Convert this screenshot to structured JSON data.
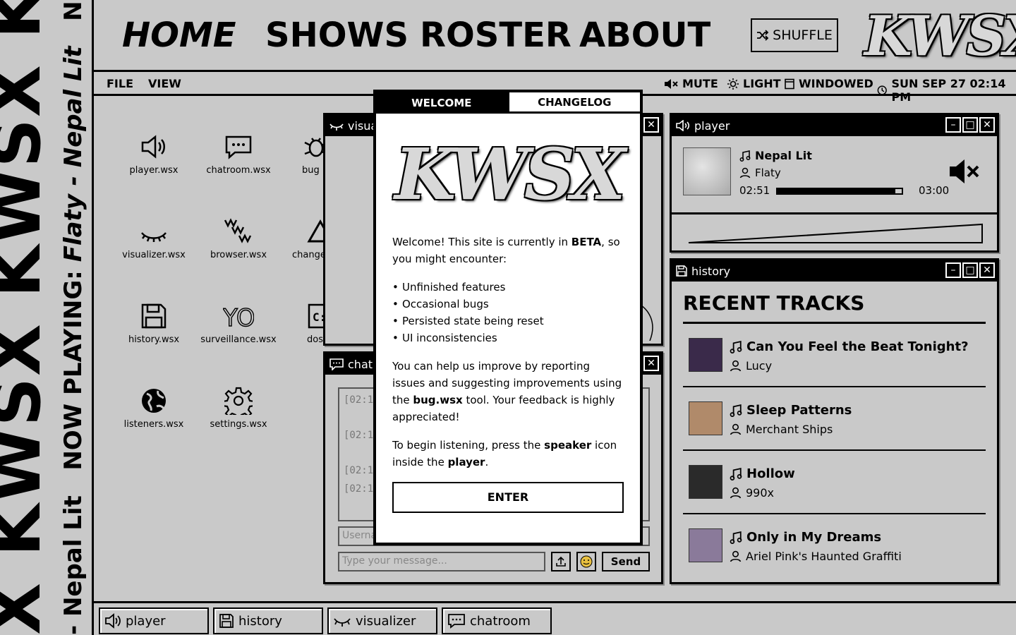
{
  "banner": {
    "big": "X KWSX KWSX KWSX KWSX",
    "now_playing_prefix": "- Nepal Lit   NOW PLAYING: ",
    "now_playing_track": "Flaty - Nepal Lit",
    "now_playing_suffix": "   NOW PLA"
  },
  "nav": {
    "home": "HOME",
    "shows": "SHOWS",
    "roster": "ROSTER",
    "about": "ABOUT",
    "shuffle": "SHUFFLE",
    "logo": "KWSX"
  },
  "menubar": {
    "file": "FILE",
    "view": "VIEW",
    "mute": "MUTE",
    "light": "LIGHT",
    "windowed": "WINDOWED",
    "datetime": "SUN SEP 27 02:14 PM"
  },
  "desktop_icons": [
    {
      "label": "player.wsx",
      "icon": "speaker-icon"
    },
    {
      "label": "chatroom.wsx",
      "icon": "chat-icon"
    },
    {
      "label": "bug",
      "icon": "bug-icon"
    },
    {
      "label": "visualizer.wsx",
      "icon": "eye-closed-icon"
    },
    {
      "label": "browser.wsx",
      "icon": "www-icon"
    },
    {
      "label": "change",
      "icon": "changelog-icon"
    },
    {
      "label": "history.wsx",
      "icon": "floppy-icon"
    },
    {
      "label": "surveillance.wsx",
      "icon": "you-icon"
    },
    {
      "label": "dos",
      "icon": "dos-icon"
    },
    {
      "label": "listeners.wsx",
      "icon": "globe-icon"
    },
    {
      "label": "settings.wsx",
      "icon": "gear-icon"
    }
  ],
  "visualizer_window": {
    "title": "visual"
  },
  "chat_window": {
    "title": "chatro",
    "log": [
      "[02:1",
      "[02:1",
      "[02:1",
      "[02:1"
    ],
    "username_placeholder": "Userna",
    "message_placeholder": "Type your message...",
    "send": "Send"
  },
  "player": {
    "title": "player",
    "track": "Nepal Lit",
    "artist": "Flaty",
    "current_time": "02:51",
    "total_time": "03:00",
    "progress": 0.95
  },
  "history": {
    "title": "history",
    "heading": "RECENT TRACKS",
    "tracks": [
      {
        "title": "Can You Feel the Beat Tonight?",
        "artist": "Lucy",
        "thumb_color": "#3a2a4a"
      },
      {
        "title": "Sleep Patterns",
        "artist": "Merchant Ships",
        "thumb_color": "#b08a6a"
      },
      {
        "title": "Hollow",
        "artist": "990x",
        "thumb_color": "#2a2a2a"
      },
      {
        "title": "Only in My Dreams",
        "artist": "Ariel Pink's Haunted Graffiti",
        "thumb_color": "#8a7a9a"
      }
    ]
  },
  "taskbar": [
    {
      "label": "player",
      "icon": "speaker-icon"
    },
    {
      "label": "history",
      "icon": "floppy-icon"
    },
    {
      "label": "visualizer",
      "icon": "eye-closed-icon"
    },
    {
      "label": "chatroom",
      "icon": "chat-icon"
    }
  ],
  "modal": {
    "tab_welcome": "WELCOME",
    "tab_changelog": "CHANGELOG",
    "logo": "KWSX",
    "p1_a": "Welcome! This site is currently in ",
    "p1_b": "BETA",
    "p1_c": ", so you might encounter:",
    "bullets": [
      "Unfinished features",
      "Occasional bugs",
      "Persisted state being reset",
      "UI inconsistencies"
    ],
    "p2_a": "You can help us improve by reporting issues and suggesting improvements using the ",
    "p2_b": "bug.wsx",
    "p2_c": " tool. Your feedback is highly appreciated!",
    "p3_a": "To begin listening, press the ",
    "p3_b": "speaker",
    "p3_c": " icon inside the ",
    "p3_d": "player",
    "p3_e": ".",
    "enter": "ENTER"
  }
}
